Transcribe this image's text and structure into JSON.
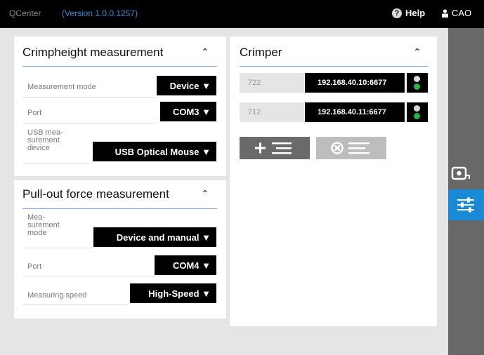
{
  "header": {
    "app_name": "QCenter",
    "version": "(Version 1.0.0.1257)",
    "help_label": "Help",
    "user_label": "CAO"
  },
  "crimpheight": {
    "title": "Crimpheight measurement",
    "rows": [
      {
        "label": "Measurement mode",
        "value": "Device ▼"
      },
      {
        "label": "Port",
        "value": "COM3 ▼"
      },
      {
        "label": "USB mea-\nsurement\ndevice",
        "value": "USB Optical Mouse ▼"
      }
    ]
  },
  "pullout": {
    "title": "Pull-out force measurement",
    "rows": [
      {
        "label": "Mea-\nsurement\nmode",
        "value": "Device and manual ▼"
      },
      {
        "label": "Port",
        "value": "COM4 ▼"
      },
      {
        "label": "Measuring speed",
        "value": "High-Speed ▼"
      }
    ]
  },
  "crimper": {
    "title": "Crimper",
    "rows": [
      {
        "port": "722",
        "ip": "192.168.40.10:6677",
        "status": "green"
      },
      {
        "port": "712",
        "ip": "192.168.40.11:6677",
        "status": "green"
      }
    ]
  },
  "colors": {
    "accent": "#1a8ad4",
    "version_text": "#2d8bd3",
    "status_ok": "#2bb14a",
    "status_off": "#d8d8d8",
    "action_button": "#6a6a6a",
    "action_button_disabled": "#bdbdbd"
  },
  "icons": {
    "help": "question-circle-icon",
    "user": "user-icon",
    "collapse": "chevron-up-icon",
    "add_list": "add-list-icon",
    "remove_list": "remove-list-icon",
    "camera": "camera-icon",
    "settings": "sliders-icon"
  }
}
